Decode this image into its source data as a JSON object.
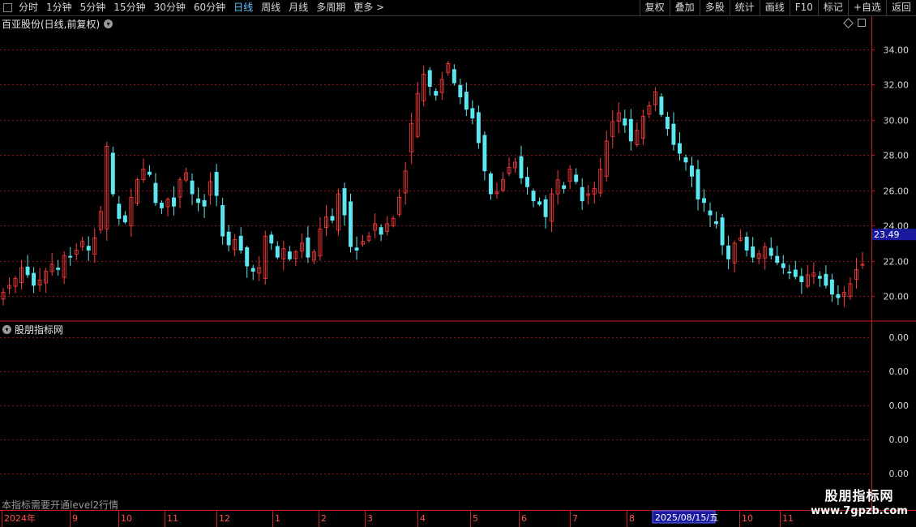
{
  "toolbar": {
    "left": [
      {
        "label": "分时",
        "active": false
      },
      {
        "label": "1分钟",
        "active": false
      },
      {
        "label": "5分钟",
        "active": false
      },
      {
        "label": "15分钟",
        "active": false
      },
      {
        "label": "30分钟",
        "active": false
      },
      {
        "label": "60分钟",
        "active": false
      },
      {
        "label": "日线",
        "active": true
      },
      {
        "label": "周线",
        "active": false
      },
      {
        "label": "月线",
        "active": false
      },
      {
        "label": "多周期",
        "active": false
      },
      {
        "label": "更多 >",
        "active": false
      }
    ],
    "right": [
      "复权",
      "叠加",
      "多股",
      "统计",
      "画线",
      "F10",
      "标记",
      "+自选",
      "返回"
    ]
  },
  "main_title": "百亚股份(日线,前复权)",
  "sub_title": "股朋指标网",
  "note": "本指标需要开通level2行情",
  "watermark": {
    "line1": "股朋指标网",
    "line2": "www.7gpzb.com"
  },
  "colors": {
    "up": "#ff3c3c",
    "down": "#5ce6f0",
    "grid": "#8a1a1a",
    "axis": "#c81e1e",
    "price_box": "#1a1aa0",
    "date_box": "#1a1aa0"
  },
  "chart_data": {
    "type": "candlestick",
    "title": "百亚股份(日线,前复权)",
    "ylim": [
      19.0,
      35.0
    ],
    "y_ticks": [
      "34.00",
      "32.00",
      "30.00",
      "28.00",
      "26.00",
      "24.00",
      "22.00",
      "20.00"
    ],
    "current_price": "23.49",
    "x_labels": [
      "2024年",
      "9",
      "10",
      "11",
      "12",
      "1",
      "2",
      "3",
      "4",
      "5",
      "6",
      "7",
      "8",
      "10",
      "11"
    ],
    "date_highlight": "2025/08/15/五",
    "close_series": [
      20.2,
      20.6,
      21.0,
      21.6,
      21.2,
      20.6,
      20.9,
      21.4,
      21.8,
      21.5,
      22.3,
      22.2,
      22.6,
      23.1,
      22.6,
      23.3,
      24.8,
      28.5,
      25.8,
      24.4,
      24.2,
      25.6,
      26.6,
      27.2,
      26.9,
      25.3,
      25.0,
      25.5,
      25.1,
      26.6,
      27.0,
      25.8,
      25.3,
      25.1,
      26.5,
      25.7,
      23.4,
      22.9,
      23.2,
      22.6,
      21.7,
      21.4,
      21.6,
      23.4,
      23.0,
      22.2,
      22.7,
      22.1,
      22.5,
      23.0,
      22.2,
      22.5,
      23.8,
      24.5,
      24.3,
      25.8,
      24.6,
      22.8,
      22.6,
      23.1,
      23.4,
      24.1,
      23.5,
      24.1,
      24.4,
      25.6,
      27.1,
      29.8,
      31.5,
      32.6,
      31.9,
      31.4,
      32.3,
      33.2,
      32.1,
      31.3,
      30.6,
      30.1,
      28.7,
      27.1,
      25.8,
      25.9,
      26.6,
      27.3,
      27.6,
      26.7,
      26.2,
      25.4,
      25.2,
      24.5,
      25.8,
      26.6,
      26.1,
      27.2,
      26.5,
      25.4,
      25.8,
      26.1,
      27.2,
      28.8,
      29.9,
      30.4,
      29.7,
      28.8,
      29.4,
      30.2,
      30.8,
      31.6,
      30.3,
      29.5,
      28.6,
      28.1,
      27.6,
      26.8,
      25.5,
      25.3,
      24.6,
      24.1,
      22.9,
      22.1,
      23.0,
      23.3,
      22.6,
      22.2,
      22.4,
      22.8,
      22.3,
      21.9,
      21.6,
      21.3,
      21.1,
      20.8,
      21.2,
      21.3,
      21.0,
      20.6,
      20.1,
      19.9,
      20.2,
      20.7,
      21.5,
      21.8
    ]
  }
}
